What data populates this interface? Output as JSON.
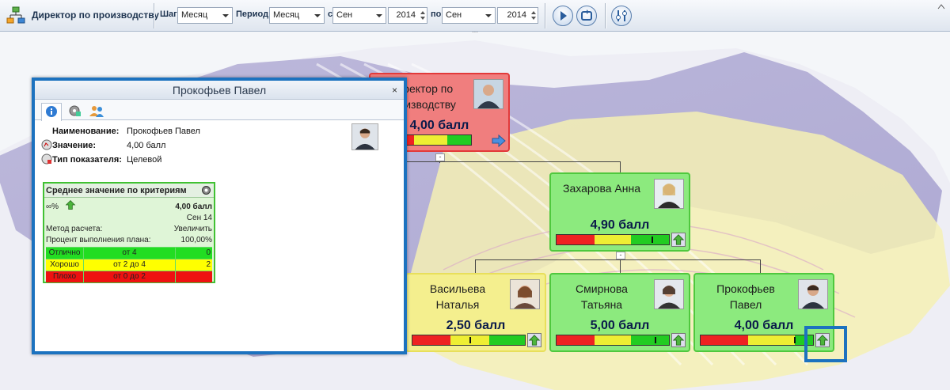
{
  "toolbar": {
    "title": "Директор по производству",
    "step_label": "Шаг:",
    "step_value": "Месяц",
    "period_label": "Период:",
    "period_value": "Месяц",
    "from_label": "с",
    "from_month": "Сен",
    "from_year": "2014",
    "to_label": "по",
    "to_month": "Сен",
    "to_year": "2014"
  },
  "cards": {
    "director": {
      "name": "Директор по производству",
      "score": "4,00 балл"
    },
    "zakharova": {
      "name": "Захарова Анна",
      "score": "4,90 балл"
    },
    "vasilyeva": {
      "name": "Васильева Наталья",
      "score": "2,50 балл"
    },
    "smirnova": {
      "name": "Смирнова Татьяна",
      "score": "5,00 балл"
    },
    "prokofyev": {
      "name": "Прокофьев Павел",
      "score": "4,00 балл"
    }
  },
  "window": {
    "title": "Прокофьев Павел",
    "close": "×",
    "name_label": "Наименование:",
    "name_value": "Прокофьев Павел",
    "value_label": "Значение:",
    "value_value": "4,00 балл",
    "type_label": "Тип показателя:",
    "type_value": "Целевой",
    "criteria": {
      "title": "Среднее значение по критериям",
      "percent": "∞%",
      "score": "4,00 балл",
      "period": "Сен 14",
      "method_label": "Метод расчета:",
      "method_value": "Увеличить",
      "plan_label": "Процент выполнения плана:",
      "plan_value": "100,00%",
      "levels": [
        {
          "name": "Отлично",
          "range": "от 4",
          "count": "0",
          "color": "#22dd22"
        },
        {
          "name": "Хорошо",
          "range": "от 2 до 4",
          "count": "2",
          "color": "#ffff00"
        },
        {
          "name": "Плохо",
          "range": "от 0 до 2",
          "count": "",
          "color": "#ee1111"
        }
      ]
    }
  },
  "colors": {
    "accent": "#1c72bf",
    "good": "#8cea7e",
    "bad": "#f07e7e",
    "mid": "#f4ef8e"
  }
}
